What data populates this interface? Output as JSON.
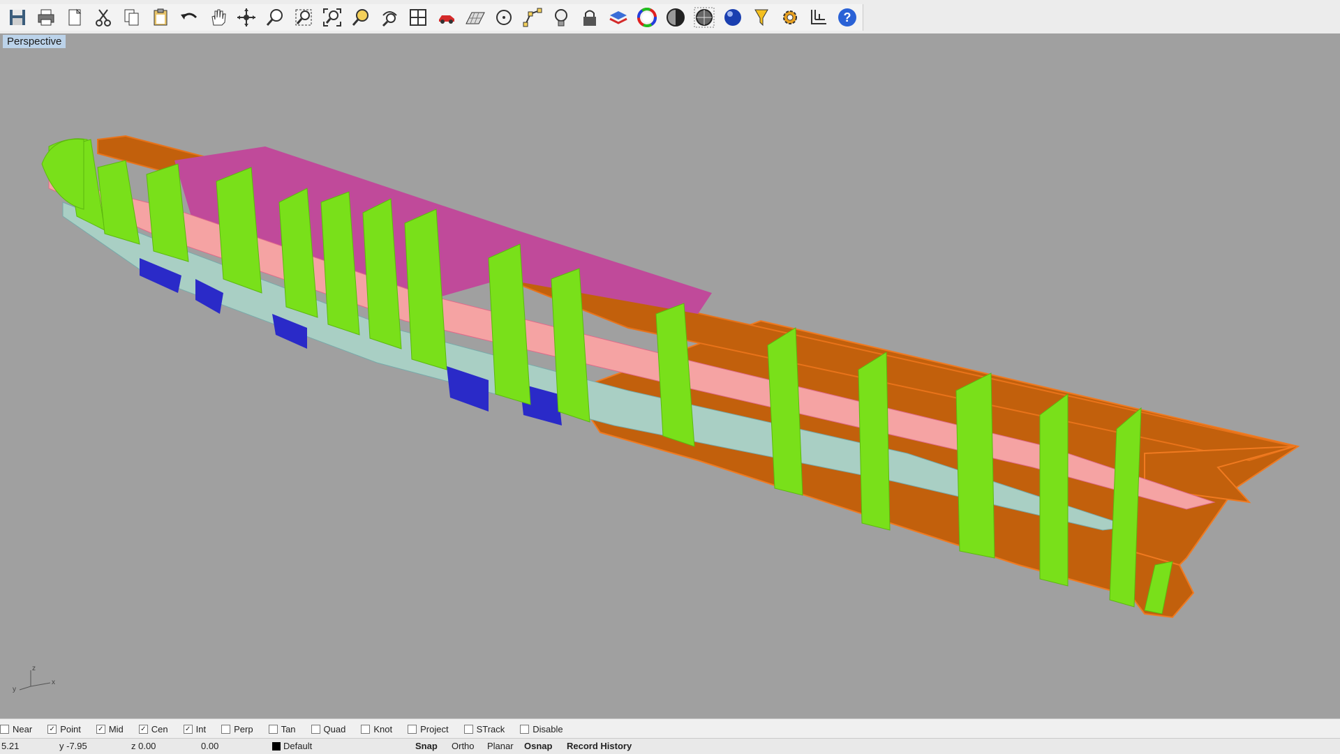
{
  "toolbar": {
    "icons": [
      "save-icon",
      "print-icon",
      "open-icon",
      "cut-icon",
      "copy-icon",
      "paste-icon",
      "undo-icon",
      "pan-icon",
      "rotate-icon",
      "zoom-icon",
      "zoom-window-icon",
      "zoom-extents-icon",
      "zoom-selected-icon",
      "rotate-view-icon",
      "four-viewports-icon",
      "car-icon",
      "grid-plane-icon",
      "point-icon",
      "snap-points-icon",
      "light-icon",
      "lock-icon",
      "layer-icon",
      "color-wheel-icon",
      "shaded-icon",
      "render-icon",
      "sphere-icon",
      "select-filter-icon",
      "options-gear-icon",
      "dimension-icon",
      "help-icon"
    ]
  },
  "viewport": {
    "label": "Perspective",
    "axis": {
      "x": "x",
      "y": "y",
      "z": "z"
    }
  },
  "snaps": [
    {
      "label": "Near",
      "checked": false
    },
    {
      "label": "Point",
      "checked": true
    },
    {
      "label": "Mid",
      "checked": true
    },
    {
      "label": "Cen",
      "checked": true
    },
    {
      "label": "Int",
      "checked": true
    },
    {
      "label": "Perp",
      "checked": false
    },
    {
      "label": "Tan",
      "checked": false
    },
    {
      "label": "Quad",
      "checked": false
    },
    {
      "label": "Knot",
      "checked": false
    },
    {
      "label": "Project",
      "checked": false
    },
    {
      "label": "STrack",
      "checked": false
    },
    {
      "label": "Disable",
      "checked": false
    }
  ],
  "status": {
    "x": "5.21",
    "y": "y -7.95",
    "z": "z 0.00",
    "distance": "0.00",
    "layer": "Default",
    "snap": "Snap",
    "ortho": "Ortho",
    "planar": "Planar",
    "osnap": "Osnap",
    "record_history": "Record History"
  },
  "colors": {
    "viewport_bg": "#a0a0a0",
    "frames": "#79e01a",
    "hull_orange": "#c2600c",
    "bulkhead_magenta": "#c04a9a",
    "deck_pink": "#f5a3a3",
    "keel_blue": "#2a2ac8",
    "bottom_pale": "#a9cfc4"
  }
}
